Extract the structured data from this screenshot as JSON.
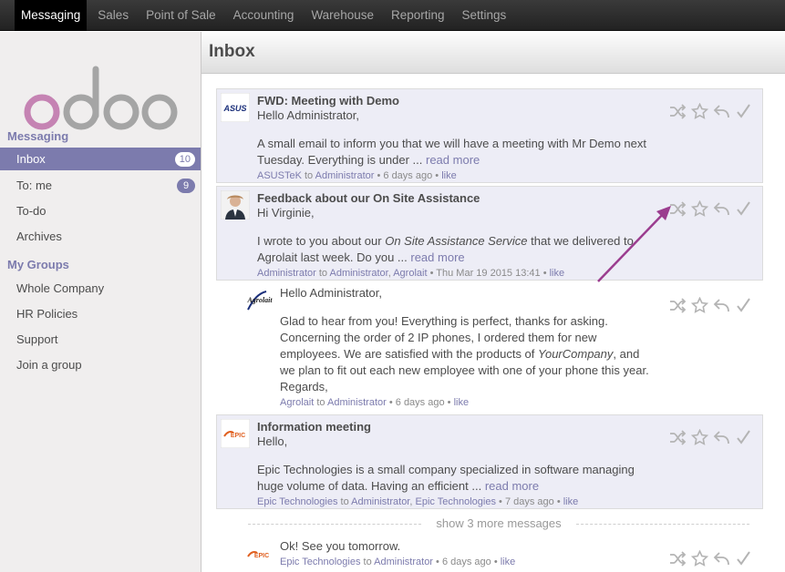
{
  "topmenu": [
    "Messaging",
    "Sales",
    "Point of Sale",
    "Accounting",
    "Warehouse",
    "Reporting",
    "Settings"
  ],
  "sidebar": {
    "section1": "Messaging",
    "items1": [
      {
        "label": "Inbox",
        "badge": "10"
      },
      {
        "label": "To: me",
        "badge": "9"
      },
      {
        "label": "To-do"
      },
      {
        "label": "Archives"
      }
    ],
    "section2": "My Groups",
    "items2": [
      {
        "label": "Whole Company"
      },
      {
        "label": "HR Policies"
      },
      {
        "label": "Support"
      },
      {
        "label": "Join a group"
      }
    ]
  },
  "page_title": "Inbox",
  "messages": [
    {
      "subject": "FWD: Meeting with Demo",
      "greeting": "Hello Administrator,",
      "body1": "A small email to inform you that we will have a meeting with Mr Demo next",
      "body2": "Tuesday. Everything is under ...",
      "read_more": "read more",
      "author": "ASUSTeK",
      "to": "to",
      "recipient": "Administrator",
      "time": "6 days ago",
      "like": "like"
    },
    {
      "subject": "Feedback about our On Site Assistance",
      "greeting": "Hi Virginie,",
      "body1a": "I wrote to you about our ",
      "body1b": "On Site Assistance Service",
      "body1c": " that we delivered to",
      "body2": "Agrolait last week. Do you ...",
      "read_more": "read more",
      "author": "Administrator",
      "to": "to",
      "recipient": "Administrator",
      "sep": ",",
      "recipient2": "Agrolait",
      "time": "Thu Mar 19 2015 13:41",
      "like": "like"
    },
    {
      "greeting": "Hello Administrator,",
      "body1": "Glad to hear from you! Everything is perfect, thanks for asking.",
      "body2": "Concerning the order of 2 IP phones, I ordered them for new",
      "body3a": "employees. We are satisfied with the products of ",
      "body3b": "YourCompany",
      "body3c": ", and",
      "body4": "we plan to fit out each new employee with one of your phone this year.",
      "body5": "Regards,",
      "author": "Agrolait",
      "to": "to",
      "recipient": "Administrator",
      "time": "6 days ago",
      "like": "like"
    },
    {
      "subject": "Information meeting",
      "greeting": "Hello,",
      "body1": "Epic Technologies is a small company specialized in software managing",
      "body2": "huge volume of data. Having an efficient ...",
      "read_more": "read more",
      "author": "Epic Technologies",
      "to": "to",
      "recipient": "Administrator",
      "sep": ",",
      "recipient2": "Epic Technologies",
      "time": "7 days ago",
      "like": "like"
    },
    {
      "greeting": "Ok! See you tomorrow.",
      "author": "Epic Technologies",
      "to": "to",
      "recipient": "Administrator",
      "time": "6 days ago",
      "like": "like"
    }
  ],
  "show_more": "show 3 more messages",
  "logos": {
    "asus": "ASUS",
    "agrolait": "Agrolait",
    "epic": "EPIC"
  },
  "colors": {
    "accent": "#7c7bad",
    "message_bg": "#ededf6",
    "annotation_arrow": "#9b3d8f"
  }
}
